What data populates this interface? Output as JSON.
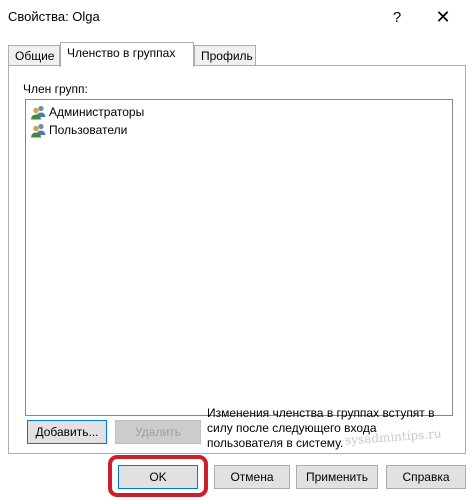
{
  "window": {
    "title": "Свойства: Olga",
    "help_glyph": "?",
    "close_glyph": "✕"
  },
  "tabs": [
    {
      "label": "Общие",
      "active": false
    },
    {
      "label": "Членство в группах",
      "active": true
    },
    {
      "label": "Профиль",
      "active": false
    }
  ],
  "membership": {
    "groups_label": "Член групп:",
    "groups": [
      {
        "name": "Администраторы",
        "icon": "user-group-icon"
      },
      {
        "name": "Пользователи",
        "icon": "user-group-icon"
      }
    ],
    "add_label": "Добавить...",
    "remove_label": "Удалить",
    "notice_lines": [
      "Изменения членства в группах вступят в",
      "силу после следующего входа",
      "пользователя в систему."
    ]
  },
  "watermark": "sysadmintips.ru",
  "footer": {
    "ok_label": "OK",
    "cancel_label": "Отмена",
    "apply_label": "Применить",
    "help_label": "Справка"
  },
  "colors": {
    "highlight": "#cc1f2b",
    "focus": "#0078d7"
  }
}
